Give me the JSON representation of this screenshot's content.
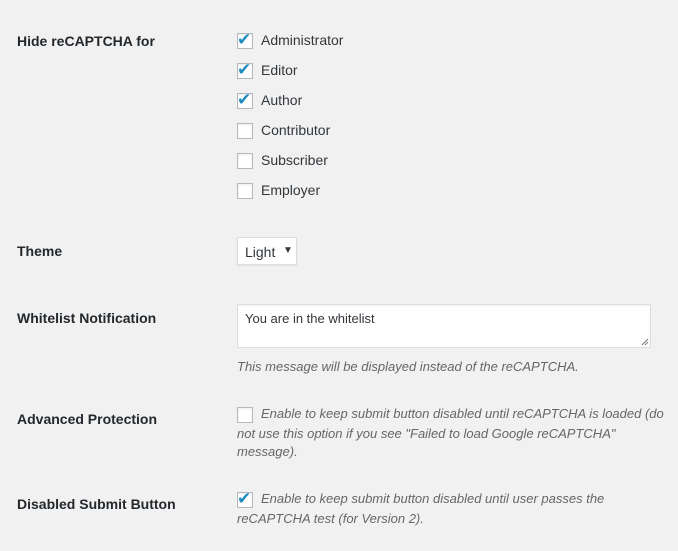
{
  "hide_recaptcha": {
    "label": "Hide reCAPTCHA for",
    "roles": [
      {
        "label": "Administrator",
        "checked": true
      },
      {
        "label": "Editor",
        "checked": true
      },
      {
        "label": "Author",
        "checked": true
      },
      {
        "label": "Contributor",
        "checked": false
      },
      {
        "label": "Subscriber",
        "checked": false
      },
      {
        "label": "Employer",
        "checked": false
      }
    ]
  },
  "theme": {
    "label": "Theme",
    "selected": "Light",
    "arrow": "▼"
  },
  "whitelist_notification": {
    "label": "Whitelist Notification",
    "value": "You are in the whitelist",
    "description": "This message will be displayed instead of the reCAPTCHA."
  },
  "advanced_protection": {
    "label": "Advanced Protection",
    "checked": false,
    "description_line1": "Enable to keep submit button disabled until reCAPTCHA is loaded (do",
    "description_line2": "not use this option if you see \"Failed to load Google reCAPTCHA\"",
    "description_line3": "message)."
  },
  "disabled_submit": {
    "label": "Disabled Submit Button",
    "checked": true,
    "description_line1": "Enable to keep submit button disabled until user passes the",
    "description_line2": "reCAPTCHA test (for Version 2)."
  },
  "icons": {
    "check": "✔"
  },
  "colors": {
    "check": "#1e8cbe",
    "background": "#f1f1f1"
  }
}
